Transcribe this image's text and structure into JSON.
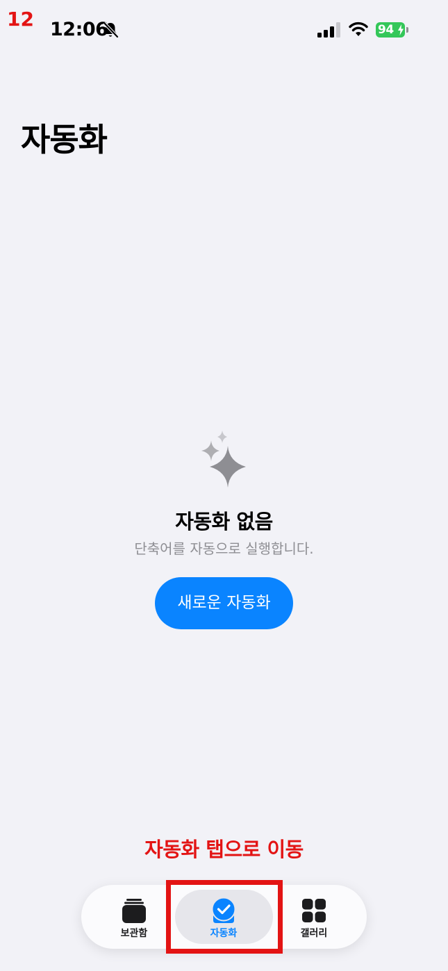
{
  "annotation": {
    "step_number": "12",
    "instruction": "자동화 탭으로 이동",
    "color": "#e31414"
  },
  "status_bar": {
    "time": "12:06",
    "battery_percent": "94",
    "icons": [
      "bell-slash-icon",
      "cellular-signal-icon",
      "wifi-icon",
      "battery-charging-icon"
    ]
  },
  "header": {
    "title": "자동화"
  },
  "empty_state": {
    "icon": "sparkles-icon",
    "title": "자동화 없음",
    "subtitle": "단축어를 자동으로 실행합니다.",
    "button_label": "새로운 자동화"
  },
  "tab_bar": {
    "tabs": [
      {
        "label": "보관함",
        "icon": "library-stack-icon",
        "active": false
      },
      {
        "label": "자동화",
        "icon": "automation-check-icon",
        "active": true
      },
      {
        "label": "갤러리",
        "icon": "gallery-grid-icon",
        "active": false
      }
    ]
  },
  "colors": {
    "background": "#f2f2f7",
    "accent": "#0a84ff",
    "battery": "#34c759",
    "secondary_text": "#8e8e93"
  }
}
